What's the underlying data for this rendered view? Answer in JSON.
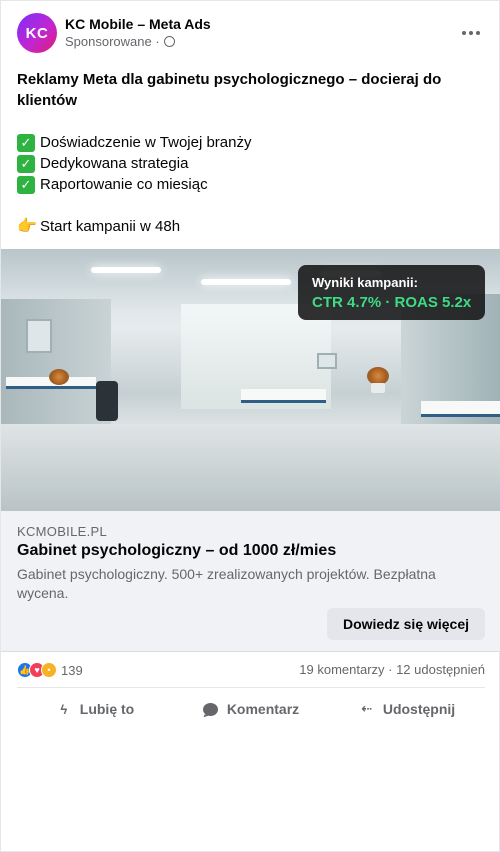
{
  "header": {
    "avatar_text": "KC",
    "page_name": "KC Mobile – Meta Ads",
    "sponsored_label": "Sponsorowane ·",
    "privacy_icon": "globe-icon",
    "more_icon": "more-options-icon"
  },
  "post": {
    "headline": "Reklamy Meta dla gabinetu psychologicznego – docieraj do klientów",
    "bullets": [
      "Doświadczenie w Twojej branży",
      "Dedykowana strategia",
      "Raportowanie co miesiąc"
    ],
    "bullet_icon": "check-mark-emoji-icon",
    "cta_line": "Start kampanii w 48h",
    "cta_line_icon": "pointing-hand-emoji-icon"
  },
  "media": {
    "overlay_label": "Wyniki kampanii:",
    "overlay_value": "CTR 4.7% · ROAS 5.2x",
    "overlay_value_color": "#3ddc84"
  },
  "link_preview": {
    "domain": "KCMOBILE.PL",
    "title": "Gabinet psychologiczny – od 1000 zł/mies",
    "description": "Gabinet psychologiczny. 500+ zrealizowanych projektów. Bezpłatna wycena.",
    "button_label": "Dowiedz się więcej"
  },
  "stats": {
    "reaction_icons": [
      "like-reaction-icon",
      "love-reaction-icon",
      "wow-reaction-icon"
    ],
    "reaction_count": "139",
    "comments_shares": "19 komentarzy · 12 udostępnień"
  },
  "actions": [
    {
      "label": "Lubię to",
      "icon": "thumbs-up-icon"
    },
    {
      "label": "Komentarz",
      "icon": "comment-icon"
    },
    {
      "label": "Udostępnij",
      "icon": "share-icon"
    }
  ],
  "colors": {
    "brand_gradient_start": "#7b2ff7",
    "brand_gradient_end": "#e11d74",
    "secondary_text": "#65676b",
    "link_box_bg": "#f0f2f5"
  }
}
